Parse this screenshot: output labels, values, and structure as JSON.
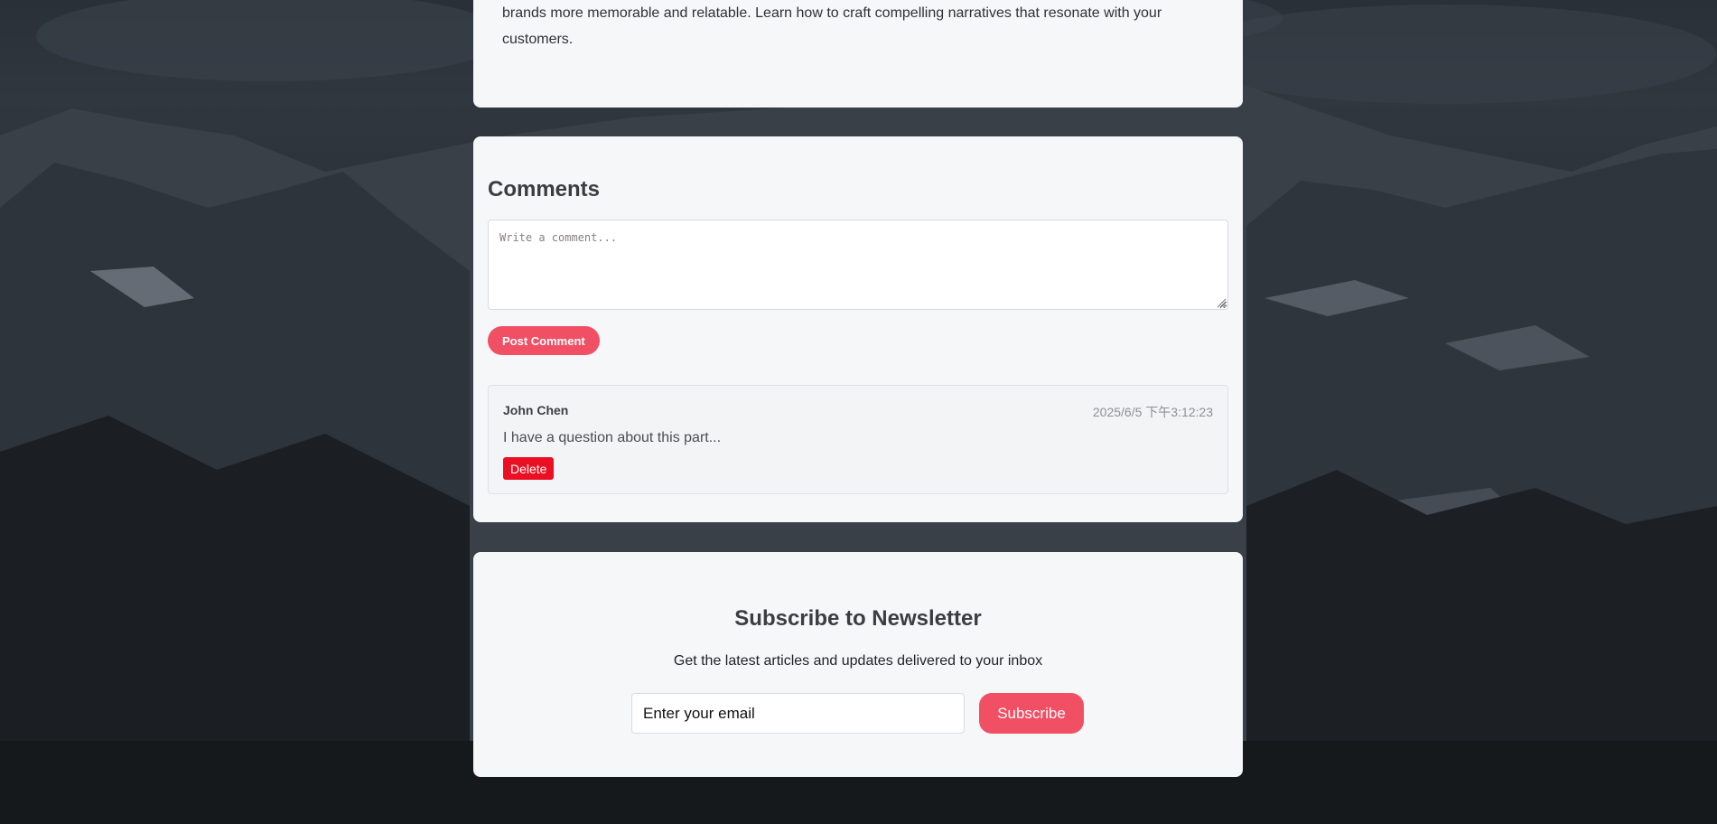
{
  "article": {
    "text": "brands more memorable and relatable. Learn how to craft compelling narratives that resonate with your customers."
  },
  "comments": {
    "title": "Comments",
    "input_placeholder": "Write a comment...",
    "post_label": "Post Comment",
    "items": [
      {
        "author": "John Chen",
        "timestamp": "2025/6/5 下午3:12:23",
        "text": "I have a question about this part...",
        "delete_label": "Delete"
      }
    ]
  },
  "newsletter": {
    "title": "Subscribe to Newsletter",
    "subtitle": "Get the latest articles and updates delivered to your inbox",
    "email_placeholder": "Enter your email",
    "subscribe_label": "Subscribe"
  },
  "colors": {
    "accent": "#f04f64",
    "danger": "#ea0f22",
    "card_bg": "#f6f7f9"
  }
}
